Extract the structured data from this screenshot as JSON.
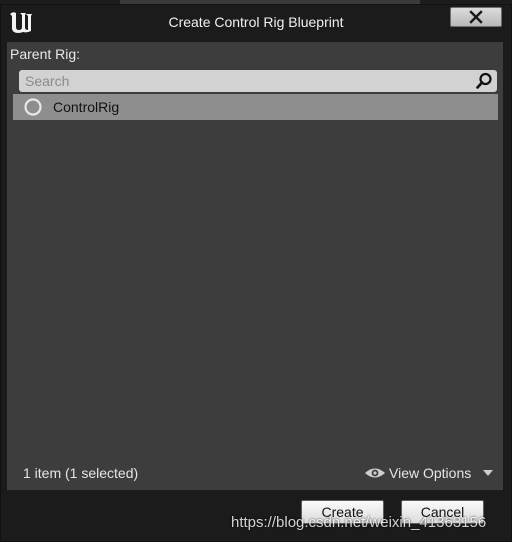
{
  "window": {
    "title": "Create Control Rig Blueprint",
    "close_icon": "close-icon",
    "logo_icon": "unreal-logo-icon"
  },
  "picker": {
    "section_label": "Parent Rig:",
    "search": {
      "placeholder": "Search",
      "value": ""
    },
    "items": [
      {
        "label": "ControlRig",
        "selected": true,
        "icon": "radio-circle-icon"
      }
    ],
    "status_text": "1 item (1 selected)",
    "view_options_label": "View Options"
  },
  "buttons": {
    "create_label": "Create",
    "cancel_label": "Cancel"
  },
  "watermark": "https://blog.csdn.net/weixin_41363156",
  "colors": {
    "panel": "#3d3d3d",
    "frame": "#1b1b1b",
    "selected_row": "#8e8e8e",
    "button": "#e6e6e6"
  }
}
